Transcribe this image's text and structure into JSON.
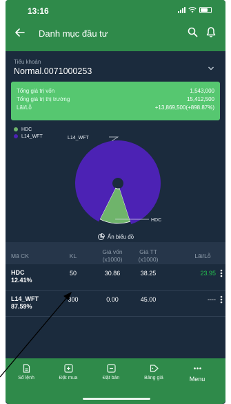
{
  "status_bar": {
    "time": "13:16"
  },
  "header": {
    "title": "Danh mục đầu tư"
  },
  "account": {
    "label": "Tiểu khoản",
    "value": "Normal.0071000253"
  },
  "summary": {
    "rows": [
      {
        "label": "Tổng giá trị vốn",
        "value": "1,543,000"
      },
      {
        "label": "Tổng giá trị thị trường",
        "value": "15,412,500"
      },
      {
        "label": "Lãi/Lỗ",
        "value": "+13,869,500(+898.87%)"
      }
    ]
  },
  "chart_data": {
    "type": "pie",
    "series": [
      {
        "name": "HDC",
        "value": 12.41,
        "color": "#6fb46b"
      },
      {
        "name": "L14_WFT",
        "value": 87.59,
        "color": "#4c22b4"
      }
    ],
    "labels": [
      "L14_WFT",
      "HDC"
    ],
    "legend": "top-left"
  },
  "chart_toggle": {
    "label": "Ẩn biểu đồ"
  },
  "table": {
    "headers": [
      "Mã CK",
      "KL",
      "Giá vốn\n(x1000)",
      "Giá TT\n(x1000)",
      "Lãi/Lỗ"
    ],
    "rows": [
      {
        "code": "HDC",
        "weight": "12.41%",
        "qty": "50",
        "cost": "30.86",
        "market": "38.25",
        "pl": "23.95",
        "pl_color": "#24c24f"
      },
      {
        "code": "L14_WFT",
        "weight": "87.59%",
        "qty": "300",
        "cost": "0.00",
        "market": "45.00",
        "pl": "----",
        "pl_color": "#ffffff"
      }
    ]
  },
  "bottom_nav": {
    "items": [
      {
        "label": "Sổ lệnh",
        "icon": "document-icon"
      },
      {
        "label": "Đặt mua",
        "icon": "plus-square-icon"
      },
      {
        "label": "Đặt bán",
        "icon": "minus-square-icon"
      },
      {
        "label": "Bảng giá",
        "icon": "tag-icon"
      },
      {
        "label": "Menu",
        "icon": "more-icon"
      }
    ]
  },
  "colors": {
    "brand": "#2f8a4a",
    "panel": "#56c770",
    "background": "#1b2b3d"
  }
}
